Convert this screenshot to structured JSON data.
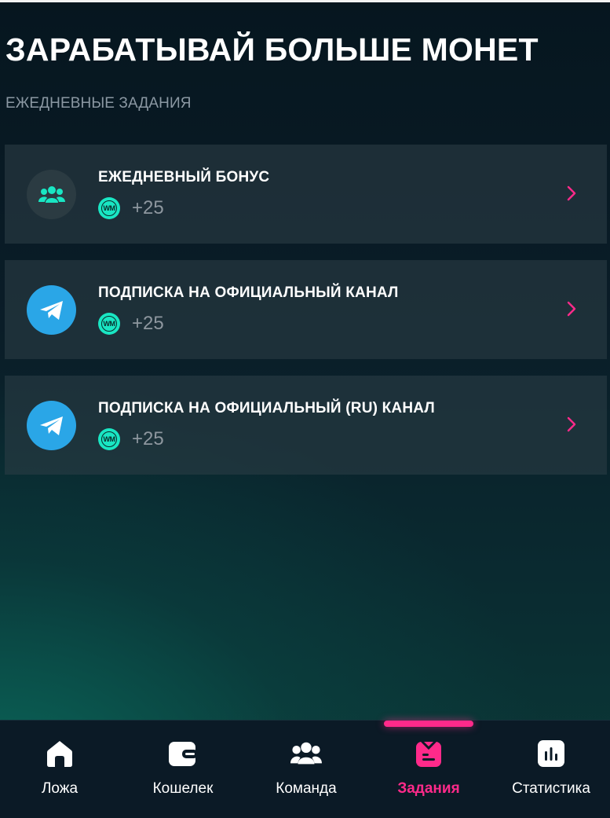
{
  "header": {
    "title": "ЗАРАБАТЫВАЙ БОЛЬШЕ МОНЕТ",
    "section_label": "ЕЖЕДНЕВНЫЕ ЗАДАНИЯ"
  },
  "tasks": [
    {
      "title": "ЕЖЕДНЕВНЫЙ БОНУС",
      "icon": "team-icon",
      "coin": "WM",
      "reward": "+25"
    },
    {
      "title": "ПОДПИСКА НА ОФИЦИАЛЬНЫЙ КАНАЛ",
      "icon": "telegram-icon",
      "coin": "WM",
      "reward": "+25"
    },
    {
      "title": "ПОДПИСКА НА ОФИЦИАЛЬНЫЙ (RU) КАНАЛ",
      "icon": "telegram-icon",
      "coin": "WM",
      "reward": "+25"
    }
  ],
  "nav": {
    "active": "tasks",
    "items": [
      {
        "id": "lodge",
        "label": "Ложа",
        "icon": "home-icon"
      },
      {
        "id": "wallet",
        "label": "Кошелек",
        "icon": "wallet-icon"
      },
      {
        "id": "team",
        "label": "Команда",
        "icon": "team-icon"
      },
      {
        "id": "tasks",
        "label": "Задания",
        "icon": "tasks-icon"
      },
      {
        "id": "stats",
        "label": "Статистика",
        "icon": "stats-icon"
      }
    ]
  },
  "colors": {
    "accent": "#ff2a8a",
    "coin": "#19e6c3",
    "telegram": "#2aa6e7",
    "card": "#2a3c44",
    "muted_text": "#8b98a3"
  }
}
